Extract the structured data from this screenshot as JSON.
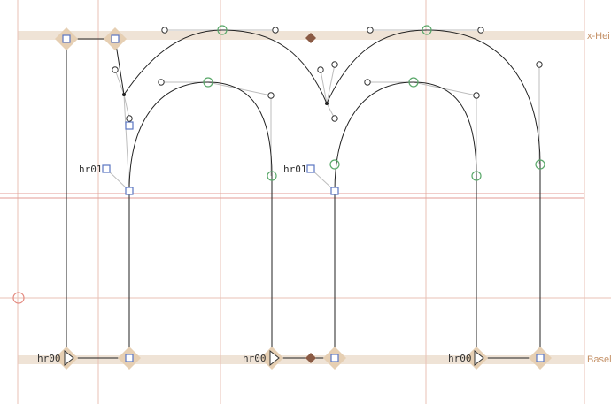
{
  "metrics": {
    "x_height_label": "x-Hei",
    "baseline_label": "Basel"
  },
  "hints": {
    "stem_labels": [
      "hr00",
      "hr00",
      "hr00"
    ],
    "round_labels": [
      "hr01",
      "hr01"
    ]
  },
  "colors": {
    "metric_band": "#efe3d6",
    "metric_text": "#c49167",
    "guide_line": "#e8c1b6",
    "alignment_zone": "#e39b95",
    "outline": "#222222",
    "handle": "#bdbdbd",
    "node_smooth": "#5aa86a",
    "node_corner": "#5a76c2",
    "anchor_marker": "#8a5a44",
    "node_diamond": "#e6cfb3",
    "origin_marker": "#e48a80"
  },
  "icons": {
    "corner_node": "square-node-icon",
    "smooth_node": "circle-node-icon",
    "offcurve_handle": "offcurve-circle-icon",
    "start_node": "triangle-start-icon",
    "anchor": "diamond-anchor-icon"
  }
}
